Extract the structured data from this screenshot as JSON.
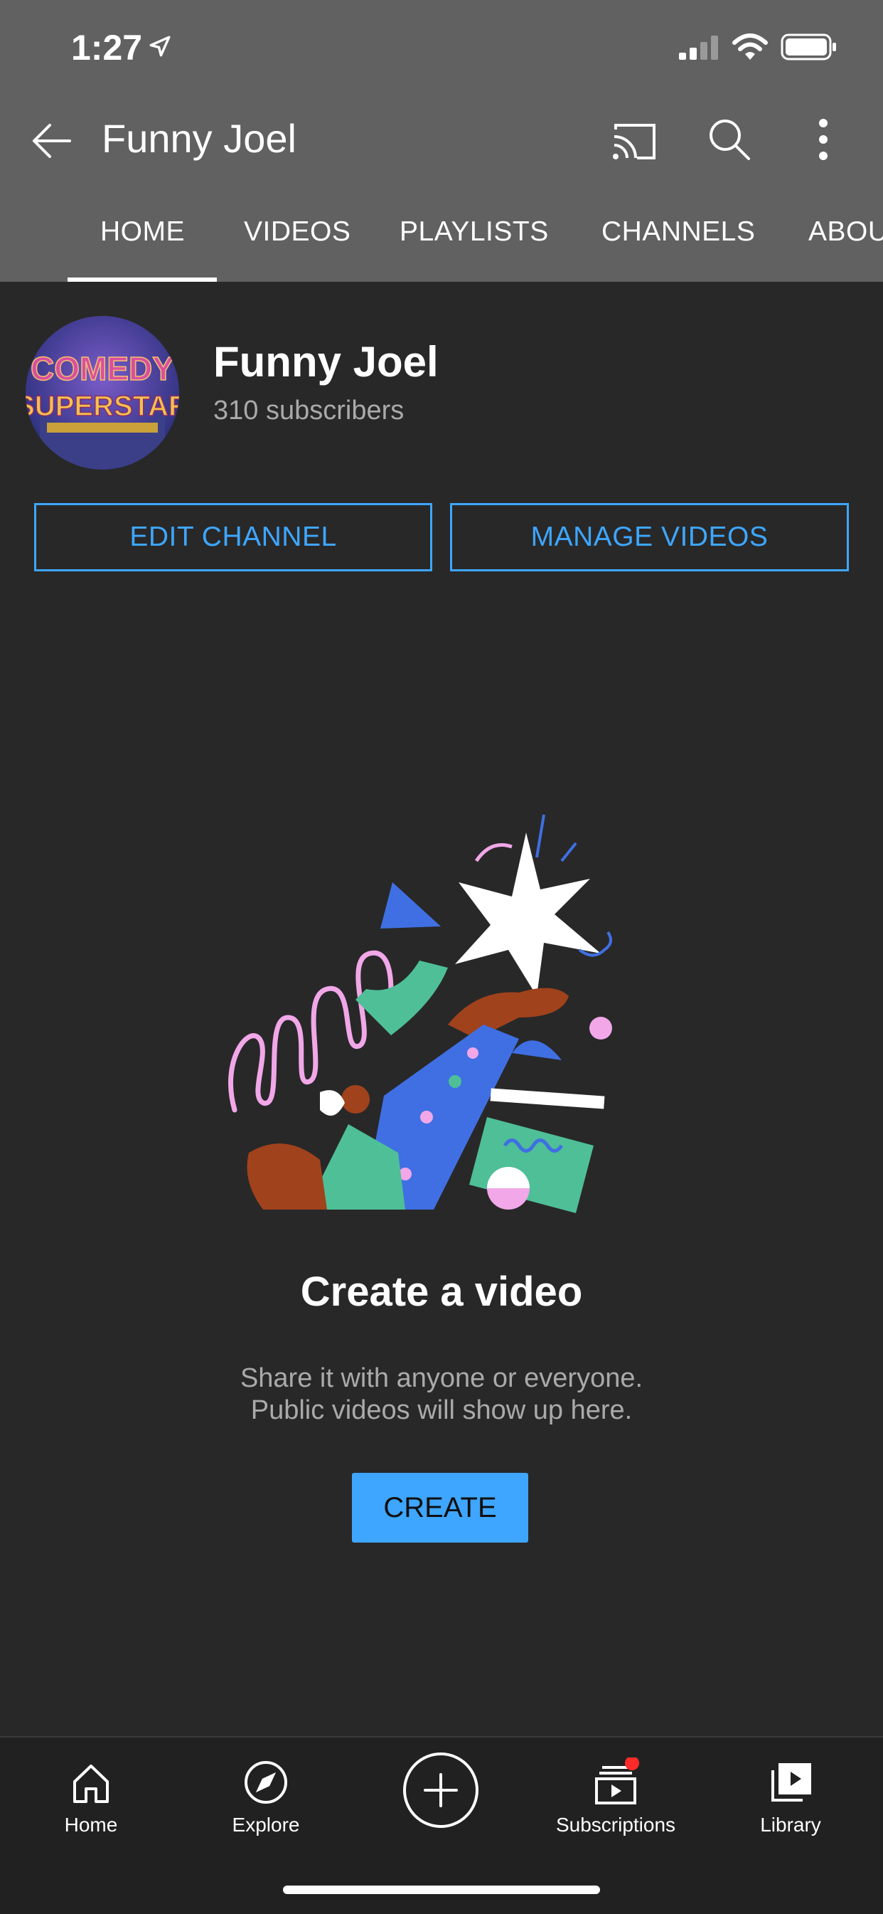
{
  "status_bar": {
    "time": "1:27"
  },
  "header": {
    "title": "Funny Joel"
  },
  "tabs": [
    {
      "label": "HOME"
    },
    {
      "label": "VIDEOS"
    },
    {
      "label": "PLAYLISTS"
    },
    {
      "label": "CHANNELS"
    },
    {
      "label": "ABOU"
    }
  ],
  "channel": {
    "name": "Funny Joel",
    "subscribers": "310 subscribers",
    "avatar_text_top": "COMEDY",
    "avatar_text_bottom": "SUPERSTAR",
    "edit_button": "EDIT CHANNEL",
    "manage_button": "MANAGE VIDEOS"
  },
  "empty_state": {
    "title": "Create a video",
    "subtitle_line1": "Share it with anyone or everyone.",
    "subtitle_line2": "Public videos will show up here.",
    "create_button": "CREATE"
  },
  "bottom_nav": {
    "home": "Home",
    "explore": "Explore",
    "subscriptions": "Subscriptions",
    "library": "Library"
  },
  "colors": {
    "header_bg": "#616161",
    "page_bg": "#282828",
    "accent_blue": "#3ea6ff",
    "notification_dot": "#ff2b2b"
  },
  "icons": [
    "location-arrow-icon",
    "signal-icon",
    "wifi-icon",
    "battery-icon",
    "back-arrow-icon",
    "cast-icon",
    "search-icon",
    "more-vert-icon",
    "home-icon",
    "explore-icon",
    "add-icon",
    "subscriptions-icon",
    "library-icon"
  ]
}
